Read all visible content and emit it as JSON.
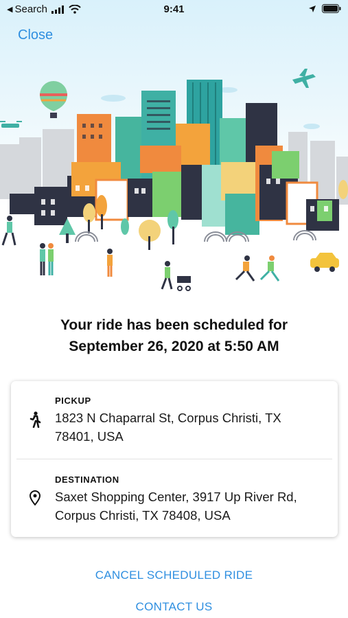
{
  "status_bar": {
    "back_label": "Search",
    "time": "9:41"
  },
  "header": {
    "close_label": "Close"
  },
  "confirmation": {
    "title_line1": "Your ride has been scheduled for",
    "title_line2": "September 26, 2020 at 5:50 AM"
  },
  "trip": {
    "pickup": {
      "label": "PICKUP",
      "address_line1": "1823 N Chaparral St, Corpus Christi, TX",
      "address_line2": "78401, USA",
      "icon": "walking-person-icon"
    },
    "destination": {
      "label": "DESTINATION",
      "address_line1": "Saxet Shopping Center, 3917 Up River Rd,",
      "address_line2": "Corpus Christi, TX 78408, USA",
      "icon": "location-pin-icon"
    }
  },
  "actions": {
    "cancel_label": "CANCEL SCHEDULED RIDE",
    "contact_label": "CONTACT US"
  },
  "colors": {
    "accent": "#2f8fe0",
    "sky": "#d9f1fb"
  }
}
